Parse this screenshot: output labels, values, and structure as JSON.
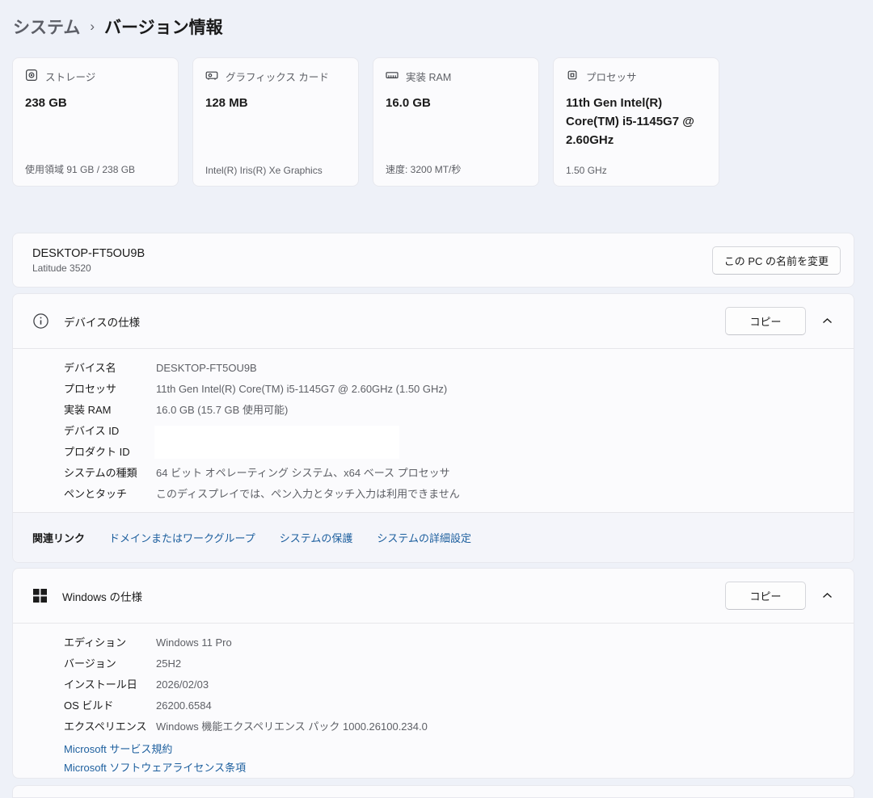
{
  "breadcrumb": {
    "parent": "システム",
    "separator": "›",
    "current": "バージョン情報"
  },
  "summary_cards": [
    {
      "icon": "storage-icon",
      "title": "ストレージ",
      "value": "238 GB",
      "detail": "使用領域 91 GB / 238 GB"
    },
    {
      "icon": "gpu-icon",
      "title": "グラフィックス カード",
      "value": "128 MB",
      "detail": "Intel(R) Iris(R) Xe Graphics"
    },
    {
      "icon": "ram-icon",
      "title": "実装 RAM",
      "value": "16.0 GB",
      "detail": "速度: 3200 MT/秒"
    },
    {
      "icon": "cpu-icon",
      "title": "プロセッサ",
      "value": "11th Gen Intel(R) Core(TM) i5-1145G7 @ 2.60GHz",
      "detail": "1.50 GHz"
    }
  ],
  "device_name_card": {
    "name": "DESKTOP-FT5OU9B",
    "model": "Latitude 3520",
    "rename_button": "この PC の名前を変更"
  },
  "device_spec": {
    "title": "デバイスの仕様",
    "copy_button": "コピー",
    "rows": [
      {
        "label": "デバイス名",
        "value": "DESKTOP-FT5OU9B"
      },
      {
        "label": "プロセッサ",
        "value": "11th Gen Intel(R) Core(TM) i5-1145G7 @ 2.60GHz (1.50 GHz)"
      },
      {
        "label": "実装 RAM",
        "value": "16.0 GB (15.7 GB 使用可能)"
      },
      {
        "label": "デバイス ID",
        "value": ""
      },
      {
        "label": "プロダクト ID",
        "value": ""
      },
      {
        "label": "システムの種類",
        "value": "64 ビット オペレーティング システム、x64 ベース プロセッサ"
      },
      {
        "label": "ペンとタッチ",
        "value": "このディスプレイでは、ペン入力とタッチ入力は利用できません"
      }
    ],
    "related": {
      "label": "関連リンク",
      "links": [
        "ドメインまたはワークグループ",
        "システムの保護",
        "システムの詳細設定"
      ]
    }
  },
  "windows_spec": {
    "title": "Windows の仕様",
    "copy_button": "コピー",
    "rows": [
      {
        "label": "エディション",
        "value": "Windows 11 Pro"
      },
      {
        "label": "バージョン",
        "value": "25H2"
      },
      {
        "label": "インストール日",
        "value": "2026/02/03"
      },
      {
        "label": "OS ビルド",
        "value": "26200.6584"
      },
      {
        "label": "エクスペリエンス",
        "value": "Windows 機能エクスペリエンス パック 1000.26100.234.0"
      }
    ],
    "links": [
      "Microsoft サービス規約",
      "Microsoft ソフトウェアライセンス条項"
    ]
  },
  "colors": {
    "link_blue": "#1d5f9e",
    "page_bg": "#eef1f8",
    "card_bg": "#fbfbfd"
  }
}
